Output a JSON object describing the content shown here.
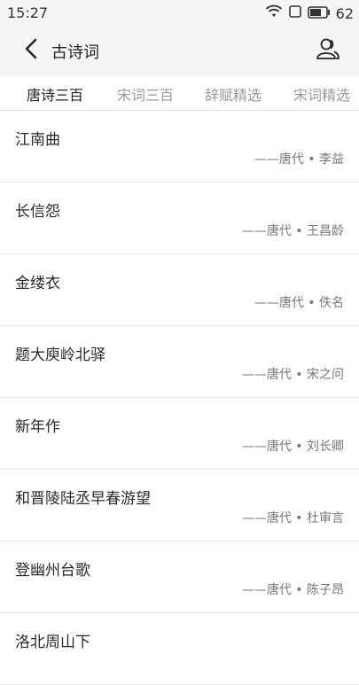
{
  "status_bar": {
    "time": "15:27",
    "battery": "62",
    "icons": [
      "wifi-icon",
      "screen-rotate-icon",
      "battery-icon"
    ]
  },
  "header": {
    "title": "古诗词",
    "back_icon": "chevron-left-icon",
    "user_icon": "user-icon"
  },
  "tabs": [
    {
      "label": "唐诗三百",
      "active": true
    },
    {
      "label": "宋词三百",
      "active": false
    },
    {
      "label": "辞赋精选",
      "active": false
    },
    {
      "label": "宋词精选",
      "active": false
    }
  ],
  "poems": [
    {
      "title": "江南曲",
      "author": "——唐代 • 李益"
    },
    {
      "title": "长信怨",
      "author": "——唐代 • 王昌龄"
    },
    {
      "title": "金缕衣",
      "author": "——唐代 • 佚名"
    },
    {
      "title": "题大庾岭北驿",
      "author": "——唐代 • 宋之问"
    },
    {
      "title": "新年作",
      "author": "——唐代 • 刘长卿"
    },
    {
      "title": "和晋陵陆丞早春游望",
      "author": "——唐代 • 杜审言"
    },
    {
      "title": "登幽州台歌",
      "author": "——唐代 • 陈子昂"
    },
    {
      "title": "洛北周山下",
      "author": ""
    }
  ],
  "colors": {
    "bar_bg": "#f5f5f5",
    "text_primary": "#222222",
    "text_secondary": "#777777",
    "tab_inactive": "#9a9a9a",
    "divider": "#ececec"
  }
}
